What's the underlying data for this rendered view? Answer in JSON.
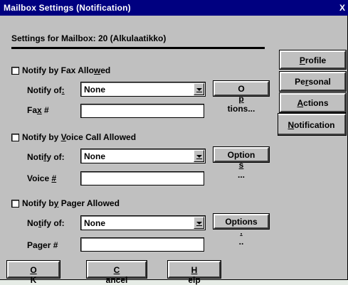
{
  "window": {
    "title": "Mailbox Settings (Notification)",
    "close_glyph": "X"
  },
  "header": {
    "settings_label": "Settings for Mailbox: 20  (Alkulaatikko)"
  },
  "tabs": [
    {
      "pre": "",
      "u": "P",
      "post": "rofile"
    },
    {
      "pre": "Pe",
      "u": "r",
      "post": "sonal"
    },
    {
      "pre": "",
      "u": "A",
      "post": "ctions"
    },
    {
      "pre": "",
      "u": "N",
      "post": "otification"
    }
  ],
  "fax": {
    "allowed": {
      "pre": "Notify by Fax Allo",
      "u": "w",
      "post": "ed",
      "checked": false
    },
    "notify_of": {
      "pre": "Notify of",
      "u": ":",
      "post": ""
    },
    "notify_value": "None",
    "options": {
      "pre": "O",
      "u": "p",
      "post": "tions..."
    },
    "number_label": {
      "pre": "Fa",
      "u": "x",
      "post": " #"
    },
    "number_value": ""
  },
  "voice": {
    "allowed": {
      "pre": "Notify by ",
      "u": "V",
      "post": "oice Call Allowed",
      "checked": false
    },
    "notify_of": {
      "pre": "Noti",
      "u": "f",
      "post": "y of:"
    },
    "notify_value": "None",
    "options": {
      "pre": "Option",
      "u": "s",
      "post": "..."
    },
    "number_label": {
      "pre": "Voice ",
      "u": "#",
      "post": ""
    },
    "number_value": ""
  },
  "pager": {
    "allowed": {
      "pre": "Notify b",
      "u": "y",
      "post": " Pager Allowed",
      "checked": false
    },
    "notify_of": {
      "pre": "No",
      "u": "t",
      "post": "ify of:"
    },
    "notify_value": "None",
    "options": {
      "pre": "Options",
      "u": ".",
      "post": ".."
    },
    "number_label": {
      "pre": "Pa",
      "u": "g",
      "post": "er #"
    },
    "number_value": ""
  },
  "buttons": {
    "ok": {
      "pre": "",
      "u": "O",
      "post": "K"
    },
    "cancel": {
      "pre": "",
      "u": "C",
      "post": "ancel"
    },
    "help": {
      "pre": "",
      "u": "H",
      "post": "elp"
    }
  }
}
